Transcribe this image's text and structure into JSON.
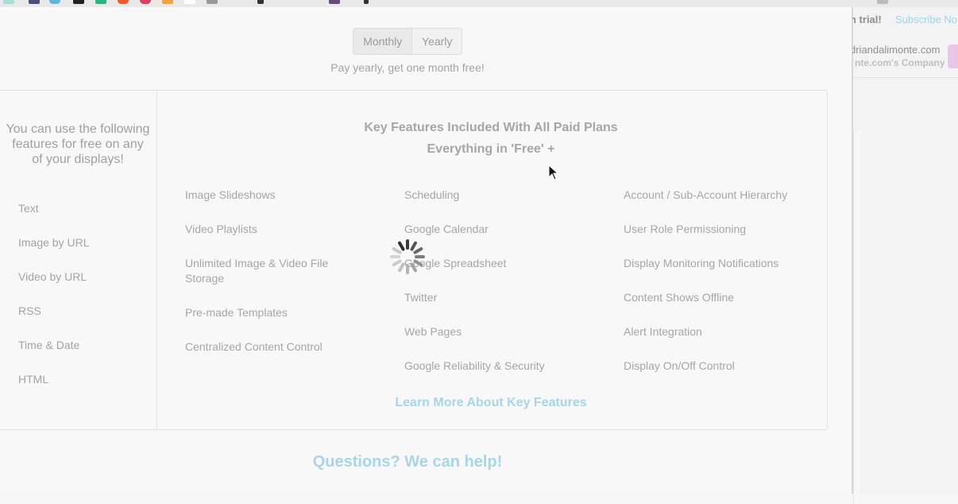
{
  "background_page": {
    "trial_text": "n trial!",
    "subscribe_text": "Subscribe No",
    "account_email": "driandalimonte.com",
    "account_company": "nte.com's Company"
  },
  "billing_toggle": {
    "monthly_label": "Monthly",
    "yearly_label": "Yearly",
    "selected": "Monthly"
  },
  "promo_text": "Pay yearly, get one month free!",
  "free_features": {
    "heading": "You can use the following features for free on any of your displays!",
    "items": [
      "Text",
      "Image by URL",
      "Video by URL",
      "RSS",
      "Time & Date",
      "HTML"
    ]
  },
  "paid_features": {
    "title": "Key Features Included With All Paid Plans",
    "subtitle": "Everything in 'Free' +",
    "column1": [
      "Image Slideshows",
      "Video Playlists",
      "Unlimited Image & Video File Storage",
      "Pre-made Templates",
      "Centralized Content Control"
    ],
    "column2": [
      "Scheduling",
      "Google Calendar",
      "Google Spreadsheet",
      "Twitter",
      "Web Pages",
      "Google Reliability & Security"
    ],
    "column3": [
      "Account / Sub-Account Hierarchy",
      "User Role Permissioning",
      "Display Monitoring Notifications",
      "Content Shows Offline",
      "Alert Integration",
      "Display On/Off Control"
    ],
    "learn_more": "Learn More About Key Features"
  },
  "help": {
    "heading": "Questions? We can help!"
  },
  "colors": {
    "accent_link": "#a6d6e8",
    "text_muted": "#a6a6a6",
    "modal_bg": "#f8f8f8"
  },
  "icons": {
    "spinner": "loading-spinner-icon",
    "cursor": "mouse-pointer-icon"
  }
}
